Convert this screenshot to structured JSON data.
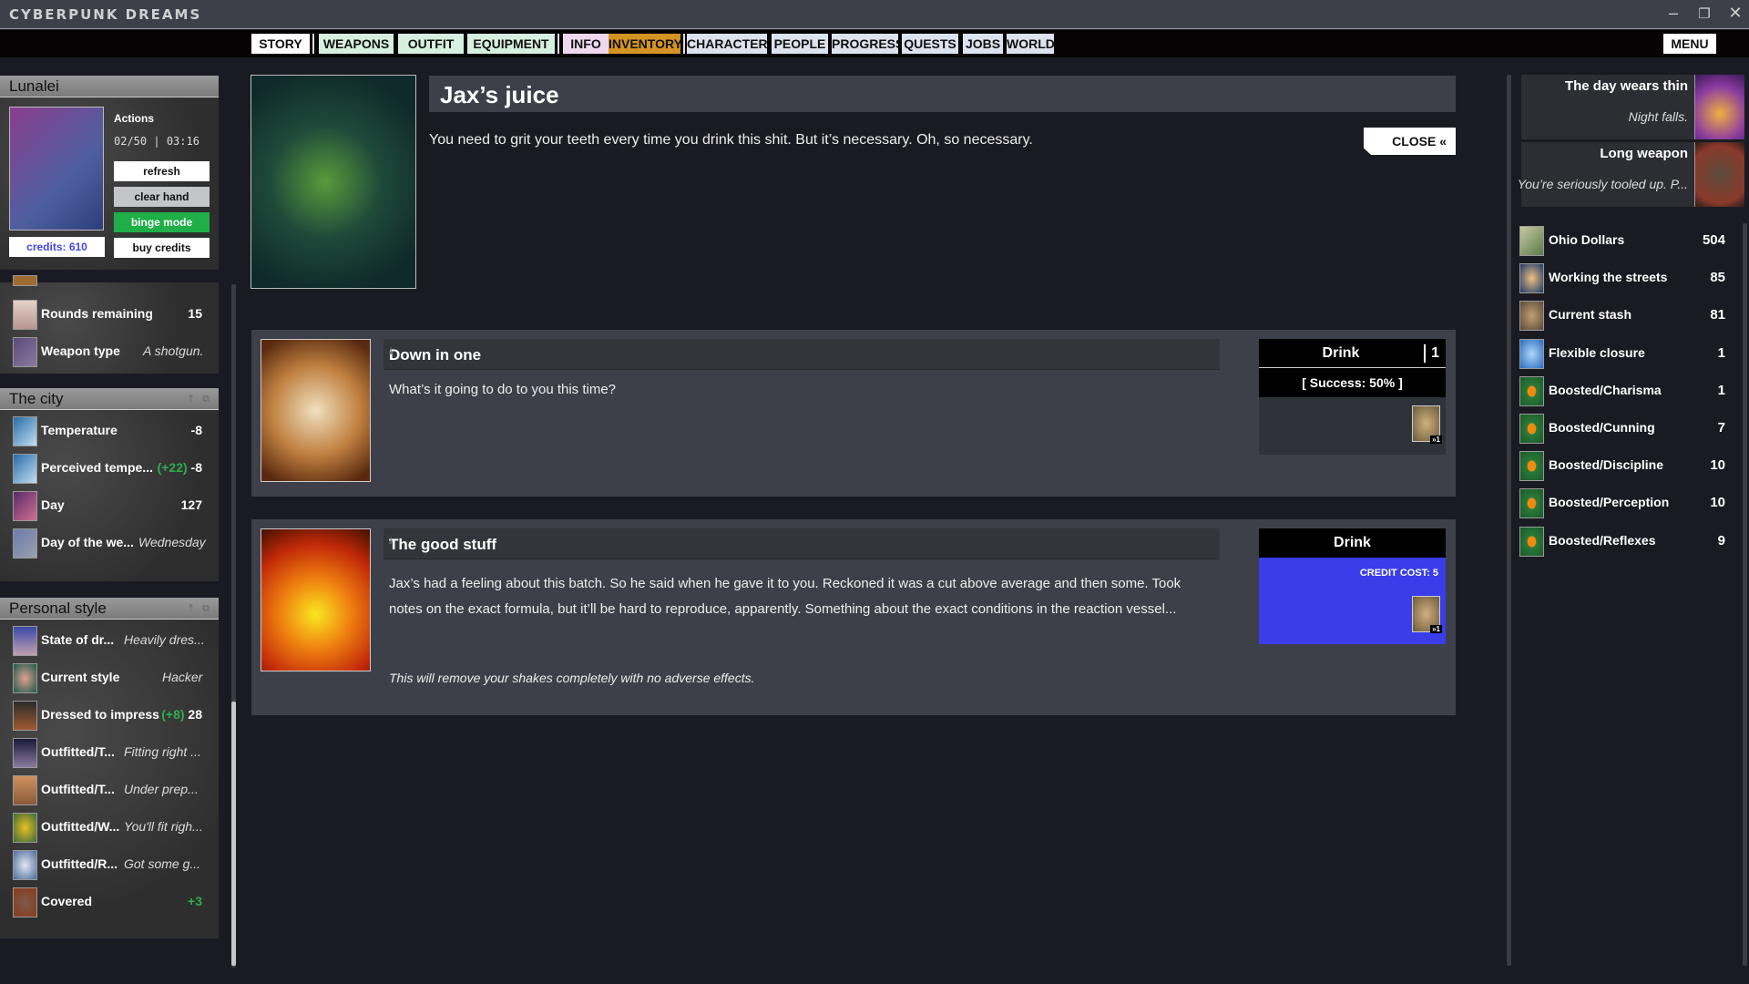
{
  "app": {
    "title": "CYBERPUNK DREAMS",
    "window_controls": [
      "minimize",
      "restore",
      "close"
    ]
  },
  "nav": {
    "tabs": [
      {
        "label": "STORY",
        "bg": "#ffffff"
      },
      {
        "label": "WEAPONS",
        "bg": "#d5efe0"
      },
      {
        "label": "OUTFIT",
        "bg": "#d5efe0"
      },
      {
        "label": "EQUIPMENT",
        "bg": "#d5efe0"
      },
      {
        "label": "INFO",
        "bg": "#efd8ef"
      },
      {
        "label": "INVENTORY",
        "bg": "#d59323"
      },
      {
        "label": "CHARACTER",
        "bg": "#dde2ef"
      },
      {
        "label": "PEOPLE",
        "bg": "#dde2ef"
      },
      {
        "label": "PROGRESS",
        "bg": "#dde2ef"
      },
      {
        "label": "QUESTS",
        "bg": "#dde2ef"
      },
      {
        "label": "JOBS",
        "bg": "#dde2ef"
      },
      {
        "label": "WORLD",
        "bg": "#dde2ef"
      }
    ],
    "menu_label": "MENU",
    "active_tab": "INVENTORY"
  },
  "character": {
    "name": "Lunalei",
    "actions_label": "Actions",
    "actions_count": "02/50",
    "timer": "03:16",
    "credits": "credits: 610",
    "buttons": {
      "refresh": "refresh",
      "clear_hand": "clear hand",
      "binge_mode": "binge mode",
      "buy_credits": "buy credits"
    }
  },
  "weapon_rows": [
    {
      "label": "Rounds remaining",
      "value": "15"
    },
    {
      "label": "Weapon type",
      "value": "A shotgun.",
      "italic": true
    }
  ],
  "city": {
    "title": "The city",
    "rows": [
      {
        "label": "Temperature",
        "value": "-8"
      },
      {
        "label": "Perceived tempe...",
        "mod": "(+22)",
        "value": "-8"
      },
      {
        "label": "Day",
        "value": "127"
      },
      {
        "label": "Day of the we...",
        "value": "Wednesday",
        "italic": true
      }
    ]
  },
  "style": {
    "title": "Personal style",
    "rows": [
      {
        "label": "State of dr...",
        "value": "Heavily dres...",
        "italic": true
      },
      {
        "label": "Current style",
        "value": "Hacker",
        "italic": true
      },
      {
        "label": "Dressed to impress",
        "mod": "(+8)",
        "value": "28"
      },
      {
        "label": "Outfitted/T...",
        "value": "Fitting right ...",
        "italic": true
      },
      {
        "label": "Outfitted/T...",
        "value": "Under prep...",
        "italic": true
      },
      {
        "label": "Outfitted/W...",
        "value": "You'll fit righ...",
        "italic": true
      },
      {
        "label": "Outfitted/R...",
        "value": "Got some g...",
        "italic": true
      },
      {
        "label": "Covered",
        "value": "+3",
        "green": true
      }
    ]
  },
  "item": {
    "title": "Jax’s juice",
    "description": "You need to grit your teeth every time you drink this shit. But it’s necessary. Oh, so necessary.",
    "close_label": "CLOSE «"
  },
  "options": [
    {
      "title": "Down in one",
      "text": "What’s it going to do to you this time?",
      "action": "Drink",
      "count": "1",
      "success": "[ Success: 50% ]",
      "cost_badge": "»1"
    },
    {
      "title": "The good stuff",
      "text": "Jax’s had a feeling about this batch. So he said when he gave it to you. Reckoned it was a cut above average and then some. Took notes on the exact formula, but it’ll be hard to reproduce, apparently. Something about the exact conditions in the reaction vessel...",
      "note": "This will remove your shakes completely with no adverse effects.",
      "action": "Drink",
      "credit_cost": "CREDIT COST: 5",
      "cost_badge": "»1",
      "accent": "#3a3de8"
    }
  ],
  "quests": [
    {
      "title": "The day wears thin",
      "subtitle": "Night falls."
    },
    {
      "title": "Long weapon",
      "subtitle": "You’re seriously tooled up. P..."
    }
  ],
  "resources": [
    {
      "label": "Ohio Dollars",
      "value": "504",
      "icon": "cash-icon"
    },
    {
      "label": "Working the streets",
      "value": "85",
      "icon": "streets-icon"
    },
    {
      "label": "Current stash",
      "value": "81",
      "icon": "stash-icon"
    },
    {
      "label": "Flexible closure",
      "value": "1",
      "icon": "closure-icon"
    },
    {
      "label": "Boosted/Charisma",
      "value": "1",
      "icon": "boost-icon"
    },
    {
      "label": "Boosted/Cunning",
      "value": "7",
      "icon": "boost-icon"
    },
    {
      "label": "Boosted/Discipline",
      "value": "10",
      "icon": "boost-icon"
    },
    {
      "label": "Boosted/Perception",
      "value": "10",
      "icon": "boost-icon"
    },
    {
      "label": "Boosted/Reflexes",
      "value": "9",
      "icon": "boost-icon"
    }
  ]
}
